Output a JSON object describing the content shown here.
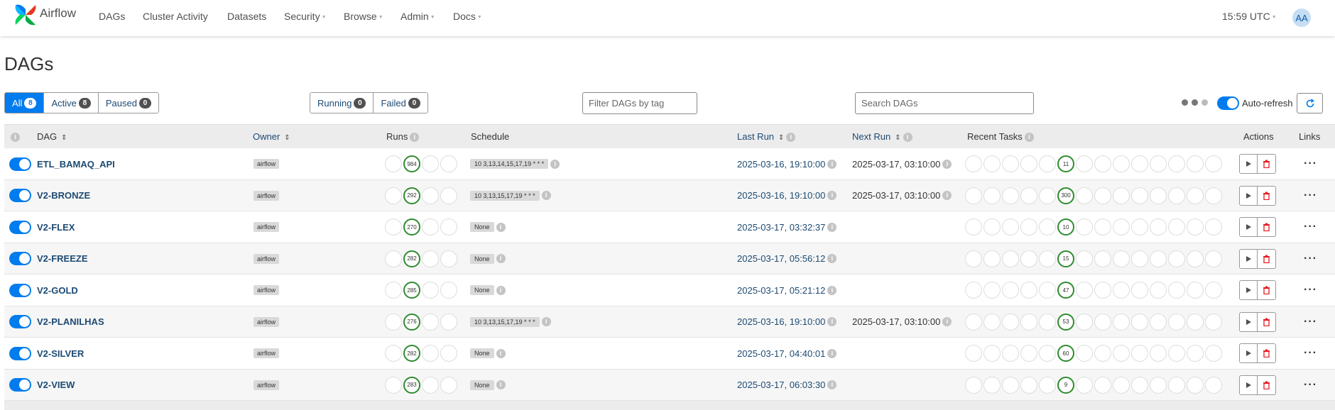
{
  "nav": {
    "brand": "Airflow",
    "items": [
      "DAGs",
      "Cluster Activity",
      "Datasets",
      "Security",
      "Browse",
      "Admin",
      "Docs"
    ],
    "time": "15:59 UTC",
    "avatar": "AA"
  },
  "page": {
    "title": "DAGs"
  },
  "filters": {
    "all": {
      "label": "All",
      "count": "8"
    },
    "active": {
      "label": "Active",
      "count": "8"
    },
    "paused": {
      "label": "Paused",
      "count": "0"
    },
    "running": {
      "label": "Running",
      "count": "0"
    },
    "failed": {
      "label": "Failed",
      "count": "0"
    },
    "tag_placeholder": "Filter DAGs by tag",
    "search_placeholder": "Search DAGs",
    "auto_refresh": "Auto-refresh"
  },
  "columns": {
    "dag": "DAG",
    "owner": "Owner",
    "runs": "Runs",
    "schedule": "Schedule",
    "last_run": "Last Run",
    "next_run": "Next Run",
    "recent_tasks": "Recent Tasks",
    "actions": "Actions",
    "links": "Links"
  },
  "colors": {
    "accent": "#017cee",
    "success": "#2e8b2e",
    "link": "#1d4a73",
    "delete": "#e51c23"
  },
  "rows": [
    {
      "name": "ETL_BAMAQ_API",
      "owner": "airflow",
      "runs": "984",
      "schedule": "10 3,13,14,15,17,19 * * *",
      "last_run": "2025-03-16, 19:10:00",
      "next_run": "2025-03-17, 03:10:00",
      "tasks": "11"
    },
    {
      "name": "V2-BRONZE",
      "owner": "airflow",
      "runs": "292",
      "schedule": "10 3,13,15,17,19 * * *",
      "last_run": "2025-03-16, 19:10:00",
      "next_run": "2025-03-17, 03:10:00",
      "tasks": "300"
    },
    {
      "name": "V2-FLEX",
      "owner": "airflow",
      "runs": "270",
      "schedule": "None",
      "last_run": "2025-03-17, 03:32:37",
      "next_run": "",
      "tasks": "10"
    },
    {
      "name": "V2-FREEZE",
      "owner": "airflow",
      "runs": "282",
      "schedule": "None",
      "last_run": "2025-03-17, 05:56:12",
      "next_run": "",
      "tasks": "15"
    },
    {
      "name": "V2-GOLD",
      "owner": "airflow",
      "runs": "285",
      "schedule": "None",
      "last_run": "2025-03-17, 05:21:12",
      "next_run": "",
      "tasks": "47"
    },
    {
      "name": "V2-PLANILHAS",
      "owner": "airflow",
      "runs": "276",
      "schedule": "10 3,13,15,17,19 * * *",
      "last_run": "2025-03-16, 19:10:00",
      "next_run": "2025-03-17, 03:10:00",
      "tasks": "53"
    },
    {
      "name": "V2-SILVER",
      "owner": "airflow",
      "runs": "282",
      "schedule": "None",
      "last_run": "2025-03-17, 04:40:01",
      "next_run": "",
      "tasks": "60"
    },
    {
      "name": "V2-VIEW",
      "owner": "airflow",
      "runs": "283",
      "schedule": "None",
      "last_run": "2025-03-17, 06:03:30",
      "next_run": "",
      "tasks": "9"
    }
  ]
}
